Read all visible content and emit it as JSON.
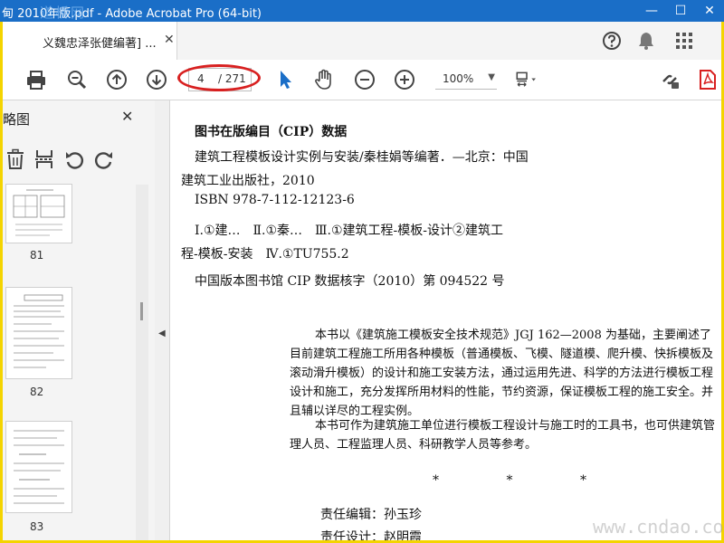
{
  "window": {
    "title": "甸 2010年版.pdf - Adobe Acrobat Pro (64-bit)",
    "watermark_top": "道桥网",
    "min_glyph": "—",
    "max_glyph": "☐",
    "close_glyph": "✕"
  },
  "tab": {
    "label": "义魏忠泽张健编著] ...",
    "close_glyph": "✕"
  },
  "toolbar": {
    "current_page": "4",
    "total_pages": "/ 271",
    "zoom": "100%",
    "zoom_arrow": "▼"
  },
  "sidebar": {
    "title": "略图",
    "close_glyph": "✕",
    "thumbnails": [
      {
        "number": "81"
      },
      {
        "number": "82"
      },
      {
        "number": "83"
      }
    ],
    "collapse_glyph": "◀"
  },
  "document": {
    "heading": "图书在版编目（CIP）数据",
    "lines": [
      "建筑工程模板设计实例与安装/秦桂娟等编著．—北京：中国",
      "建筑工业出版社，2010",
      "ISBN 978-7-112-12123-6",
      "Ⅰ.①建…　Ⅱ.①秦…　Ⅲ.①建筑工程-模板-设计②建筑工",
      "程-模板-安装　Ⅳ.①TU755.2",
      "中国版本图书馆 CIP 数据核字（2010）第 094522 号"
    ],
    "paragraph1": "本书以《建筑施工模板安全技术规范》JGJ 162—2008 为基础，主要阐述了目前建筑工程施工所用各种模板（普通模板、飞模、隧道模、爬升模、快拆模板及滚动滑升模板）的设计和施工安装方法，通过运用先进、科学的方法进行模板工程设计和施工，充分发挥所用材料的性能，节约资源，保证模板工程的施工安全。并且辅以详尽的工程实例。",
    "paragraph2": "本书可作为建筑施工单位进行模板工程设计与施工时的工具书，也可供建筑管理人员、工程监理人员、科研教学人员等参考。",
    "stars": [
      "*",
      "*",
      "*"
    ],
    "editor": "责任编辑：孙玉珍",
    "designer": "责任设计：赵明霞"
  },
  "watermark_bottom": "www.cndao.com",
  "colors": {
    "titlebar": "#1a6ec7",
    "frame": "#f4d400",
    "highlight_ellipse": "#d82020",
    "select_arrow": "#1a6ec7"
  }
}
